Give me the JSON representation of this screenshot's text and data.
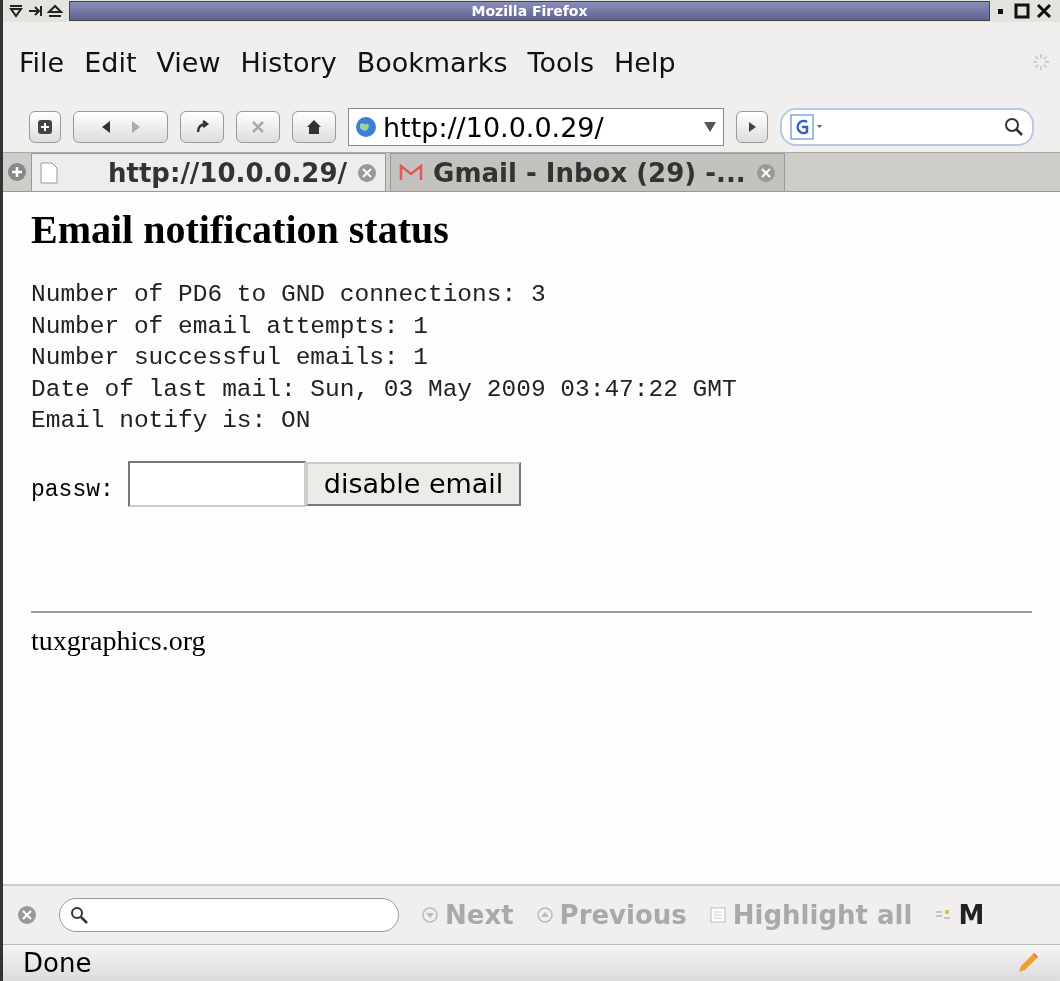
{
  "window": {
    "title": "Mozilla Firefox"
  },
  "menu": [
    {
      "label": "File"
    },
    {
      "label": "Edit"
    },
    {
      "label": "View"
    },
    {
      "label": "History"
    },
    {
      "label": "Bookmarks"
    },
    {
      "label": "Tools"
    },
    {
      "label": "Help"
    }
  ],
  "toolbar": {
    "url": "http://10.0.0.29/"
  },
  "tabs": [
    {
      "label": "http://10.0.0.29/",
      "selected": true,
      "kind": "page"
    },
    {
      "label": "Gmail - Inbox (29) -...",
      "selected": false,
      "kind": "mail"
    }
  ],
  "page": {
    "heading": "Email notification status",
    "lines": [
      "Number of PD6 to GND connections: 3",
      "Number of email attempts: 1",
      "Number successful emails: 1",
      "Date of last mail: Sun, 03 May 2009 03:47:22 GMT",
      "Email notify is: ON"
    ],
    "password_label": "passw:",
    "button": "disable email",
    "footer": "tuxgraphics.org"
  },
  "find_bar": {
    "items": [
      {
        "label": "Next",
        "disabled": true,
        "kind": "down"
      },
      {
        "label": "Previous",
        "disabled": true,
        "kind": "up"
      },
      {
        "label": "Highlight all",
        "disabled": true,
        "kind": "check"
      },
      {
        "label": "M",
        "disabled": false,
        "kind": "case"
      }
    ]
  },
  "status_bar": {
    "text": "Done"
  }
}
